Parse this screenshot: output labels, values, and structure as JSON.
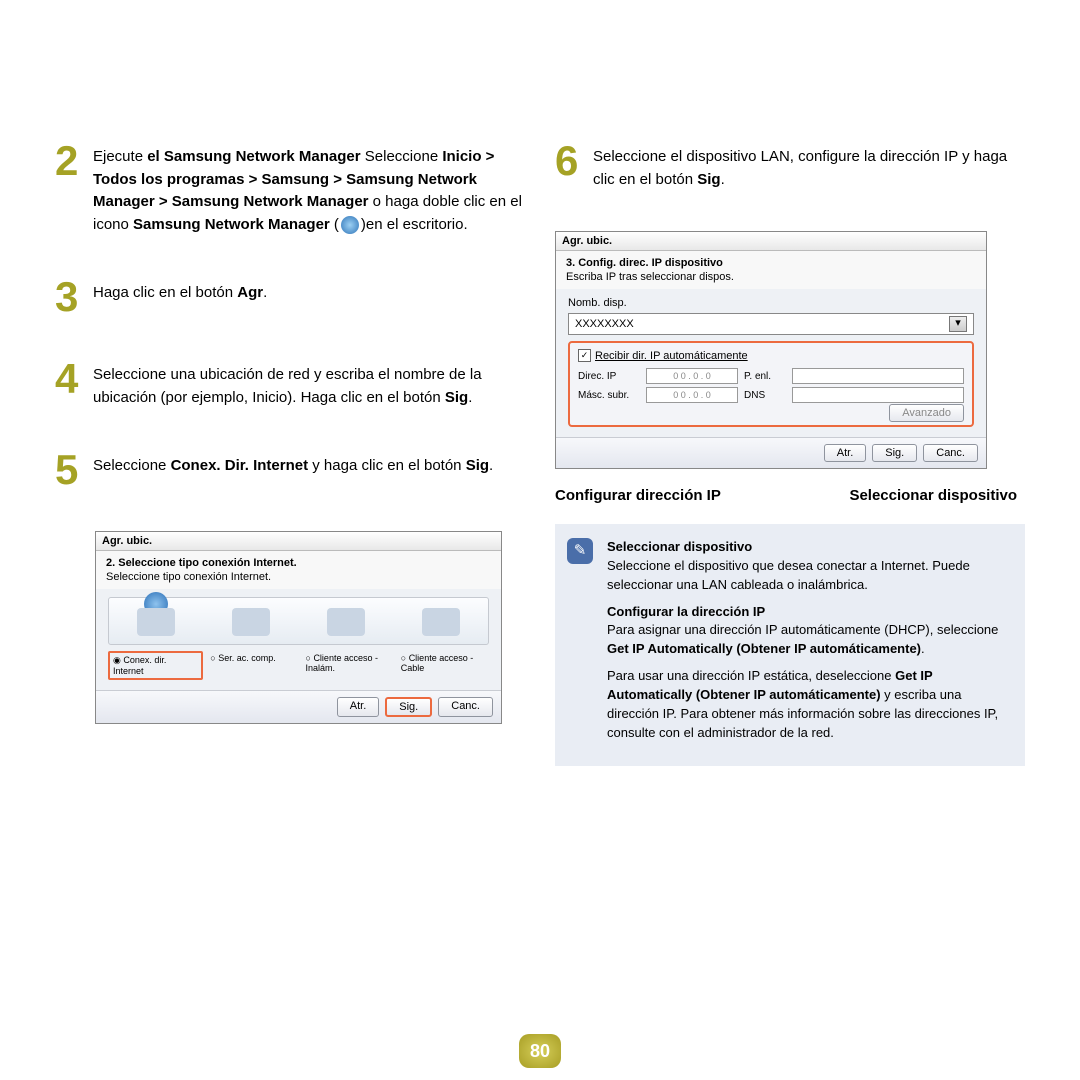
{
  "page_number": "80",
  "left": {
    "step2": {
      "num": "2",
      "run": "Ejecute ",
      "bold1": "el Samsung Network Manager",
      "sel": " Seleccione ",
      "bold2": "Inicio > Todos los programas > Samsung > Samsung Network Manager > Samsung Network Manager",
      "or": " o haga doble clic en el icono ",
      "bold3": "Samsung Network Manager",
      "paren_open": " (",
      "paren_close": ")",
      "tail": "en el escritorio."
    },
    "step3": {
      "num": "3",
      "text": "Haga clic en el botón ",
      "bold": "Agr",
      "dot": "."
    },
    "step4": {
      "num": "4",
      "text": "Seleccione una ubicación de red y escriba el nombre de la ubicación (por ejemplo, Inicio). Haga clic en el botón ",
      "bold": "Sig",
      "dot": "."
    },
    "step5": {
      "num": "5",
      "pre": "Seleccione ",
      "bold1": "Conex. Dir. Internet",
      "mid": " y haga clic en el botón ",
      "bold2": "Sig",
      "dot": "."
    },
    "shot": {
      "title": "Agr. ubic.",
      "step_label": "2. Seleccione tipo conexión Internet.",
      "desc": "Seleccione tipo conexión Internet.",
      "opts": [
        "Conex. dir. Internet",
        "Ser. ac. comp.",
        "Cliente acceso - Inalám.",
        "Cliente acceso - Cable"
      ],
      "buttons": {
        "back": "Atr.",
        "next": "Sig.",
        "cancel": "Canc."
      }
    }
  },
  "right": {
    "step6": {
      "num": "6",
      "text": "Seleccione el dispositivo LAN, configure la dirección IP y haga clic en el botón ",
      "bold": "Sig",
      "dot": "."
    },
    "shot": {
      "title": "Agr. ubic.",
      "step_label": "3. Config. direc. IP dispositivo",
      "desc": "Escriba IP tras seleccionar dispos.",
      "device_label": "Nomb. disp.",
      "device_value": "XXXXXXXX",
      "auto_label": "Recibir dir. IP automáticamente",
      "ip_label": "Direc. IP",
      "mask_label": "Másc. subr.",
      "gw_label": "P. enl.",
      "dns_label": "DNS",
      "ip_val": "0    0  .  0  .  0",
      "adv": "Avanzado",
      "buttons": {
        "back": "Atr.",
        "next": "Sig.",
        "cancel": "Canc."
      }
    },
    "callout_left": "Configurar dirección IP",
    "callout_right": "Seleccionar dispositivo",
    "info": {
      "h1": "Seleccionar dispositivo",
      "p1": "Seleccione el dispositivo que desea conectar a Internet. Puede seleccionar una LAN cableada o inalámbrica.",
      "h2": "Configurar la dirección IP",
      "p2a": "Para asignar una dirección IP automáticamente (DHCP), seleccione ",
      "p2b": "Get IP Automatically (Obtener IP automáticamente)",
      "p2c": ".",
      "p3a": "Para usar una dirección IP estática, deseleccione ",
      "p3b": "Get IP Automatically (Obtener IP automáticamente)",
      "p3c": " y escriba una dirección IP. Para obtener más información sobre las direcciones IP, consulte con el administrador de la red."
    }
  }
}
